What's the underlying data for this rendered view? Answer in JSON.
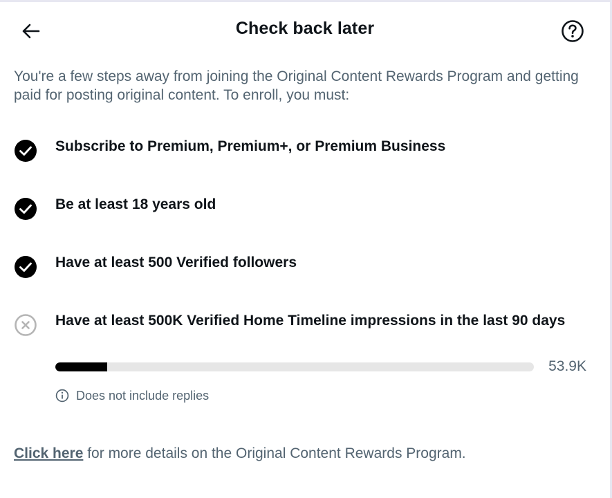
{
  "header": {
    "title": "Check back later",
    "back_icon": "arrow-left-icon",
    "help_icon": "question-circle-icon"
  },
  "intro": "You're a few steps away from joining the Original Content Rewards Program and getting paid for posting original content. To enroll, you must:",
  "requirements": [
    {
      "text": "Subscribe to Premium, Premium+, or Premium Business",
      "status": "met",
      "icon": "check-circle-icon"
    },
    {
      "text": "Be at least 18 years old",
      "status": "met",
      "icon": "check-circle-icon"
    },
    {
      "text": "Have at least 500 Verified followers",
      "status": "met",
      "icon": "check-circle-icon"
    },
    {
      "text": "Have at least 500K Verified Home Timeline impressions in the last 90 days",
      "status": "not_met",
      "icon": "x-circle-icon"
    }
  ],
  "progress": {
    "value_label": "53.9K",
    "fraction": 0.1078
  },
  "note": {
    "icon": "info-icon",
    "text": "Does not include replies"
  },
  "footer": {
    "link_text": "Click here",
    "rest_text": " for more details on the Original Content Rewards Program."
  },
  "colors": {
    "text_primary": "#0f1419",
    "text_secondary": "#536471",
    "progress_fill": "#000000",
    "progress_track": "#e6e6e6",
    "unmet_icon": "#b5b5b5"
  }
}
